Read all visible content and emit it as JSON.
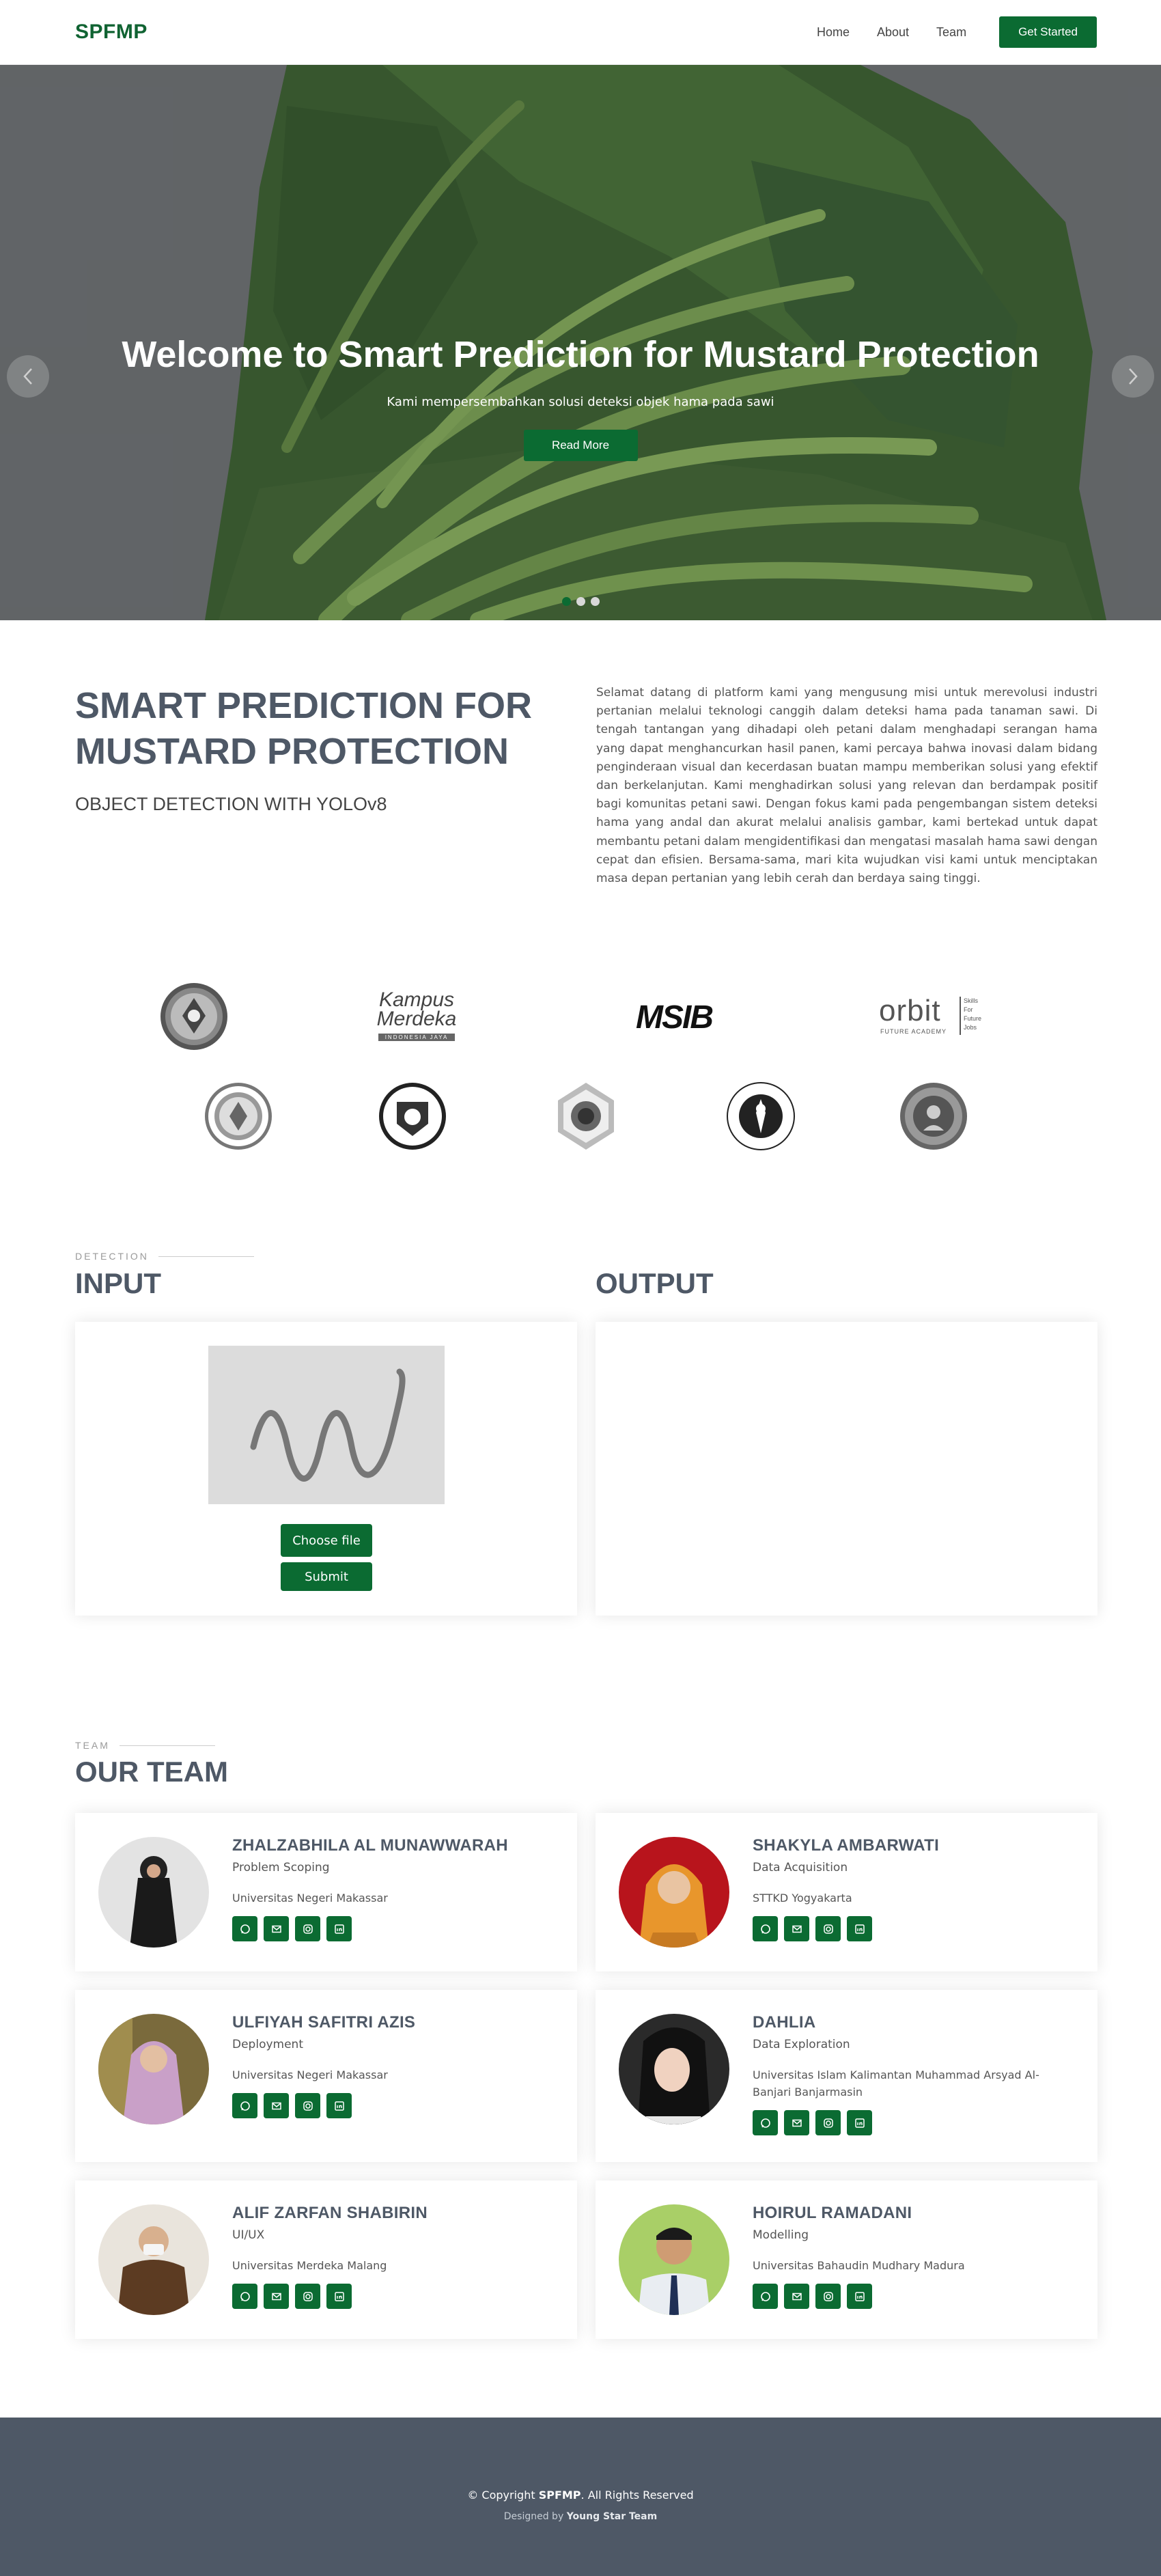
{
  "header": {
    "logo": "SPFMP",
    "nav": [
      "Home",
      "About",
      "Team"
    ],
    "cta": "Get Started"
  },
  "hero": {
    "title": "Welcome to Smart Prediction for Mustard Protection",
    "subtitle": "Kami mempersembahkan solusi deteksi objek hama pada sawi",
    "button": "Read More",
    "slides": 3,
    "active_slide": 1
  },
  "about": {
    "title_line1": "SMART PREDICTION FOR",
    "title_line2": "MUSTARD PROTECTION",
    "subtitle": "OBJECT DETECTION WITH YOLOv8",
    "text": "Selamat datang di platform kami yang mengusung misi untuk merevolusi industri pertanian melalui teknologi canggih dalam deteksi hama pada tanaman sawi. Di tengah tantangan yang dihadapi oleh petani dalam menghadapi serangan hama yang dapat menghancurkan hasil panen, kami percaya bahwa inovasi dalam bidang penginderaan visual dan kecerdasan buatan mampu memberikan solusi yang efektif dan berkelanjutan. Kami menghadirkan solusi yang relevan dan berdampak positif bagi komunitas petani sawi. Dengan fokus kami pada pengembangan sistem deteksi hama yang andal dan akurat melalui analisis gambar, kami bertekad untuk dapat membantu petani dalam mengidentifikasi dan mengatasi masalah hama sawi dengan cepat dan efisien. Bersama-sama, mari kita wujudkan visi kami untuk menciptakan masa depan pertanian yang lebih cerah dan berdaya saing tinggi."
  },
  "partners": {
    "kampus_line1": "Kampus",
    "kampus_line2": "Merdeka",
    "kampus_tag": "INDONESIA JAYA",
    "msib": "MSIB",
    "orbit": "orbit",
    "orbit_tag": "FUTURE ACADEMY",
    "orbit_side": [
      "Skills",
      "For",
      "Future",
      "Jobs"
    ]
  },
  "detection": {
    "label": "DETECTION",
    "input_title": "INPUT",
    "output_title": "OUTPUT",
    "choose_file": "Choose file",
    "submit": "Submit"
  },
  "team": {
    "label": "TEAM",
    "title": "OUR TEAM",
    "members": [
      {
        "name": "ZHALZABHILA AL MUNAWWARAH",
        "role": "Problem Scoping",
        "uni": "Universitas Negeri Makassar"
      },
      {
        "name": "SHAKYLA AMBARWATI",
        "role": "Data Acquisition",
        "uni": "STTKD Yogyakarta"
      },
      {
        "name": "ULFIYAH SAFITRI AZIS",
        "role": "Deployment",
        "uni": "Universitas Negeri Makassar"
      },
      {
        "name": "DAHLIA",
        "role": "Data Exploration",
        "uni": "Universitas Islam Kalimantan Muhammad Arsyad Al-Banjari Banjarmasin"
      },
      {
        "name": "ALIF ZARFAN SHABIRIN",
        "role": "UI/UX",
        "uni": "Universitas Merdeka Malang"
      },
      {
        "name": "HOIRUL RAMADANI",
        "role": "Modelling",
        "uni": "Universitas Bahaudin Mudhary Madura"
      }
    ]
  },
  "footer": {
    "copyright_prefix": "© Copyright",
    "brand": "SPFMP",
    "copyright_suffix": ". All Rights Reserved",
    "designed_by": "Designed by",
    "team": "Young Star Team"
  },
  "colors": {
    "brand_green": "#0b6b32",
    "heading_slate": "#4e5866",
    "footer_bg": "#4e5866"
  }
}
